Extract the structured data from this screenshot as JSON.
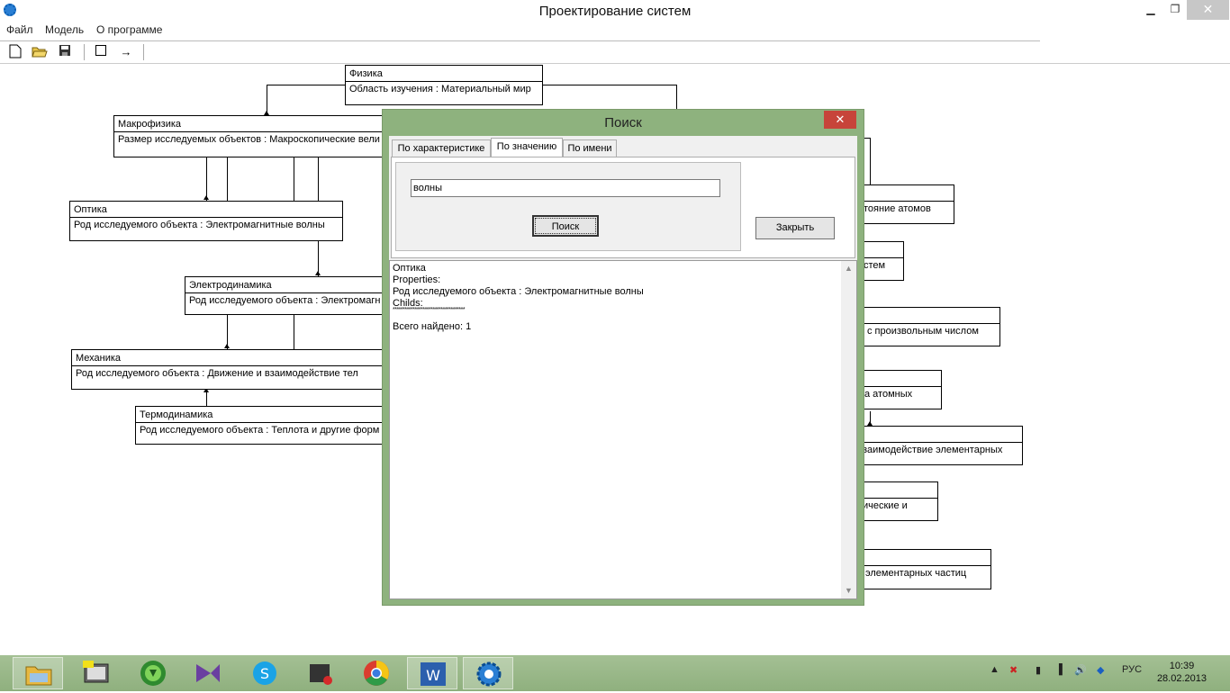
{
  "window": {
    "title": "Проектирование систем"
  },
  "menu": {
    "items": [
      "Файл",
      "Модель",
      "О программе"
    ]
  },
  "toolbar": {
    "icons": [
      "new-file-icon",
      "open-folder-icon",
      "save-icon",
      "rectangle-icon",
      "arrow-icon"
    ]
  },
  "diagram": {
    "nodes": [
      {
        "name": "Физика",
        "attr": "Область изучения : Материальный мир"
      },
      {
        "name": "Макрофизика",
        "attr": "Размер исследуемых объектов : Макроскопические вели"
      },
      {
        "name": "Оптика",
        "attr": "Род исследуемого объекта : Электромагнитные волны"
      },
      {
        "name": "Электродинамика",
        "attr": "Род исследуемого объекта : Электромагн"
      },
      {
        "name": "Механика",
        "attr": "Род исследуемого объекта :  Движение и взаимодействие тел"
      },
      {
        "name": "Термодинамика",
        "attr": "Род исследуемого объекта : Теплота и другие форм"
      },
      {
        "name": "",
        "attr": "тояние атомов"
      },
      {
        "name": "",
        "attr": "стем"
      },
      {
        "name": "",
        "attr": "с произвольным числом"
      },
      {
        "name": "",
        "attr": "а атомных"
      },
      {
        "name": "",
        "attr": "заимодействие элементарных"
      },
      {
        "name": "",
        "attr": "ические и"
      },
      {
        "name": "",
        "attr": "элементарных частиц"
      }
    ]
  },
  "dialog": {
    "title": "Поиск",
    "tabs": [
      "По характеристике",
      "По значению",
      "По имени"
    ],
    "active_tab": "По значению",
    "search_value": "волны",
    "search_button": "Поиск",
    "close_button": "Закрыть",
    "results": {
      "lines": [
        "Оптика",
        "Properties:",
        "Род исследуемого объекта : Электромагнитные волны",
        "Childs:",
        "************************************",
        "Всего найдено: 1"
      ]
    }
  },
  "taskbar": {
    "apps": [
      "file-explorer-icon",
      "notepad-icon",
      "download-icon",
      "visual-studio-icon",
      "skype-icon",
      "terminal-icon",
      "chrome-icon",
      "word-icon",
      "app-gear-icon"
    ],
    "language": "РУС",
    "time": "10:39",
    "date": "28.02.2013"
  }
}
